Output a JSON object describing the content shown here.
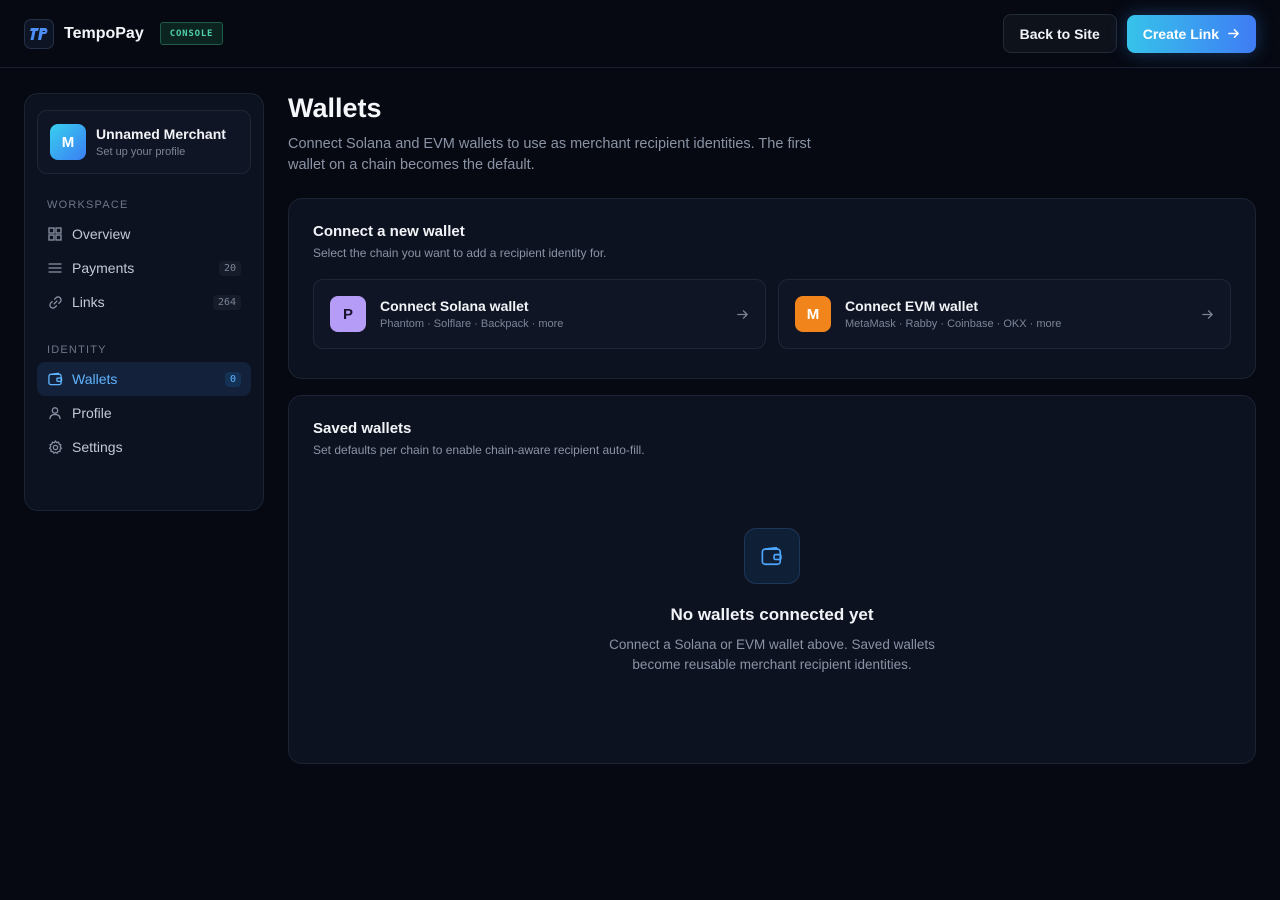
{
  "header": {
    "brand": "TempoPay",
    "badge": "CONSOLE",
    "back_label": "Back to Site",
    "create_label": "Create Link"
  },
  "sidebar": {
    "merchant": {
      "initial": "M",
      "name": "Unnamed Merchant",
      "subtitle": "Set up your profile"
    },
    "sections": [
      {
        "label": "WORKSPACE",
        "items": [
          {
            "label": "Overview",
            "icon": "grid-icon",
            "count": ""
          },
          {
            "label": "Payments",
            "icon": "list-icon",
            "count": "20"
          },
          {
            "label": "Links",
            "icon": "link-icon",
            "count": "264"
          }
        ]
      },
      {
        "label": "IDENTITY",
        "items": [
          {
            "label": "Wallets",
            "icon": "wallet-icon",
            "count": "0",
            "active": true
          },
          {
            "label": "Profile",
            "icon": "user-icon",
            "count": ""
          },
          {
            "label": "Settings",
            "icon": "gear-icon",
            "count": ""
          }
        ]
      }
    ]
  },
  "main": {
    "title": "Wallets",
    "description": "Connect Solana and EVM wallets to use as merchant recipient identities. The first wallet on a chain becomes the default.",
    "connect": {
      "title": "Connect a new wallet",
      "subtitle": "Select the chain you want to add a recipient identity for.",
      "options": [
        {
          "initial": "P",
          "title": "Connect Solana wallet",
          "subtitle": "Phantom · Solflare · Backpack · more",
          "color": "#b49cf7",
          "text_color": "#1a1430"
        },
        {
          "initial": "M",
          "title": "Connect EVM wallet",
          "subtitle": "MetaMask · Rabby · Coinbase · OKX · more",
          "color": "#f2841c",
          "text_color": "#ffffff"
        }
      ]
    },
    "saved": {
      "title": "Saved wallets",
      "subtitle": "Set defaults per chain to enable chain-aware recipient auto-fill.",
      "empty_title": "No wallets connected yet",
      "empty_desc": "Connect a Solana or EVM wallet above. Saved wallets become reusable merchant recipient identities."
    }
  },
  "colors": {
    "accent": "#5fb4ff",
    "background": "#060912",
    "panel": "#0d1220"
  }
}
